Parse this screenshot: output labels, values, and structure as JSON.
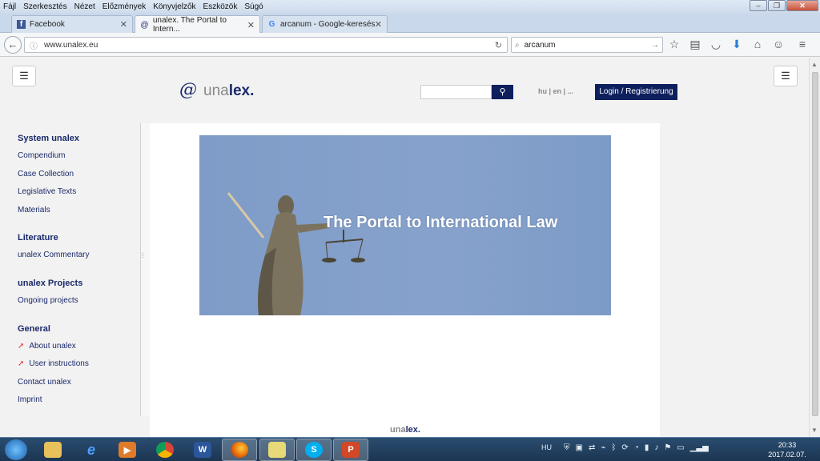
{
  "menu": [
    "Fájl",
    "Szerkesztés",
    "Nézet",
    "Előzmények",
    "Könyvjelzők",
    "Eszközök",
    "Súgó"
  ],
  "tabs": [
    {
      "label": "Facebook",
      "icon": "facebook-icon"
    },
    {
      "label": "unalex. The Portal to Intern...",
      "icon": "at-icon"
    },
    {
      "label": "arcanum - Google-keresés",
      "icon": "google-icon"
    }
  ],
  "url": "www.unalex.eu",
  "browser_search": "arcanum",
  "site": {
    "logo_una": "una",
    "logo_lex": "lex.",
    "languages": "hu | en | ...",
    "login": "Login / Registrierung",
    "banner_title": "The Portal to International Law",
    "footer_una": "una",
    "footer_lex": "lex."
  },
  "sidebar": [
    {
      "title": "System unalex",
      "items": [
        "Compendium",
        "Case Collection",
        "Legislative Texts",
        "Materials"
      ]
    },
    {
      "title": "Literature",
      "items": [
        "unalex Commentary"
      ]
    },
    {
      "title": "unalex Projects",
      "items": [
        "Ongoing projects"
      ]
    },
    {
      "title": "General",
      "items": [
        "About unalex",
        "User instructions",
        "Contact unalex",
        "Imprint"
      ]
    }
  ],
  "tray": {
    "lang": "HU",
    "time": "20:33",
    "date": "2017.02.07."
  },
  "colors": {
    "navy": "#0d1f5c",
    "banner": "#7f9cc8"
  }
}
